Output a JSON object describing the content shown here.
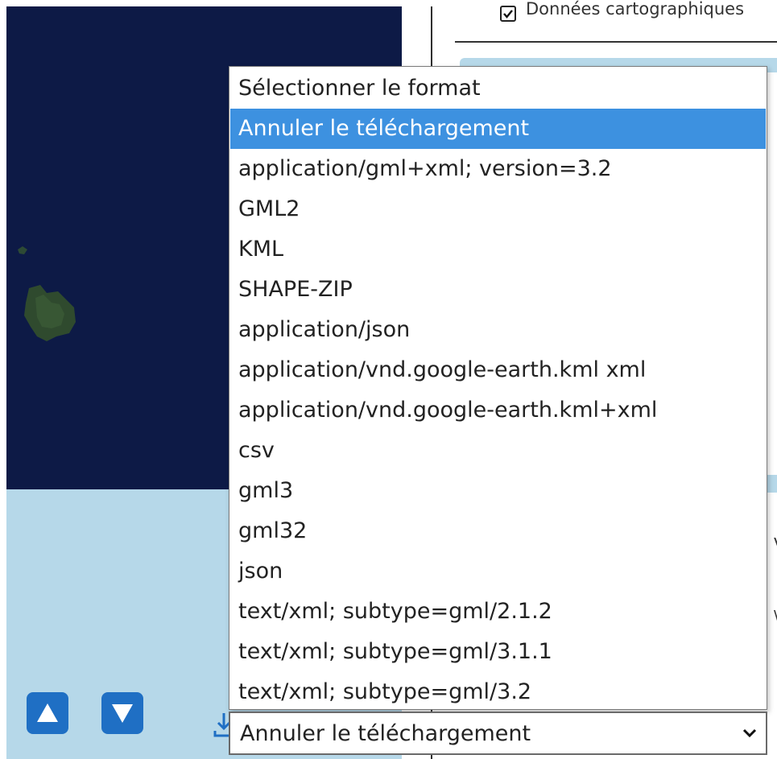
{
  "layer": {
    "checkbox_checked": true,
    "label": "Données cartographiques"
  },
  "format_select": {
    "options": [
      "Sélectionner le format",
      "Annuler le téléchargement",
      "application/gml+xml; version=3.2",
      "GML2",
      "KML",
      "SHAPE-ZIP",
      "application/json",
      "application/vnd.google-earth.kml xml",
      "application/vnd.google-earth.kml+xml",
      "csv",
      "gml3",
      "gml32",
      "json",
      "text/xml; subtype=gml/2.1.2",
      "text/xml; subtype=gml/3.1.1",
      "text/xml; subtype=gml/3.2"
    ],
    "highlighted_index": 1,
    "selected_value": "Annuler le téléchargement"
  },
  "map": {
    "up_icon": "triangle-up-icon",
    "down_icon": "triangle-down-icon",
    "download_icon": "download-icon"
  },
  "colors": {
    "map_ocean": "#0d1a46",
    "map_background": "#b6d8e9",
    "map_button": "#1f6fc4",
    "highlight": "#3d91e0"
  }
}
